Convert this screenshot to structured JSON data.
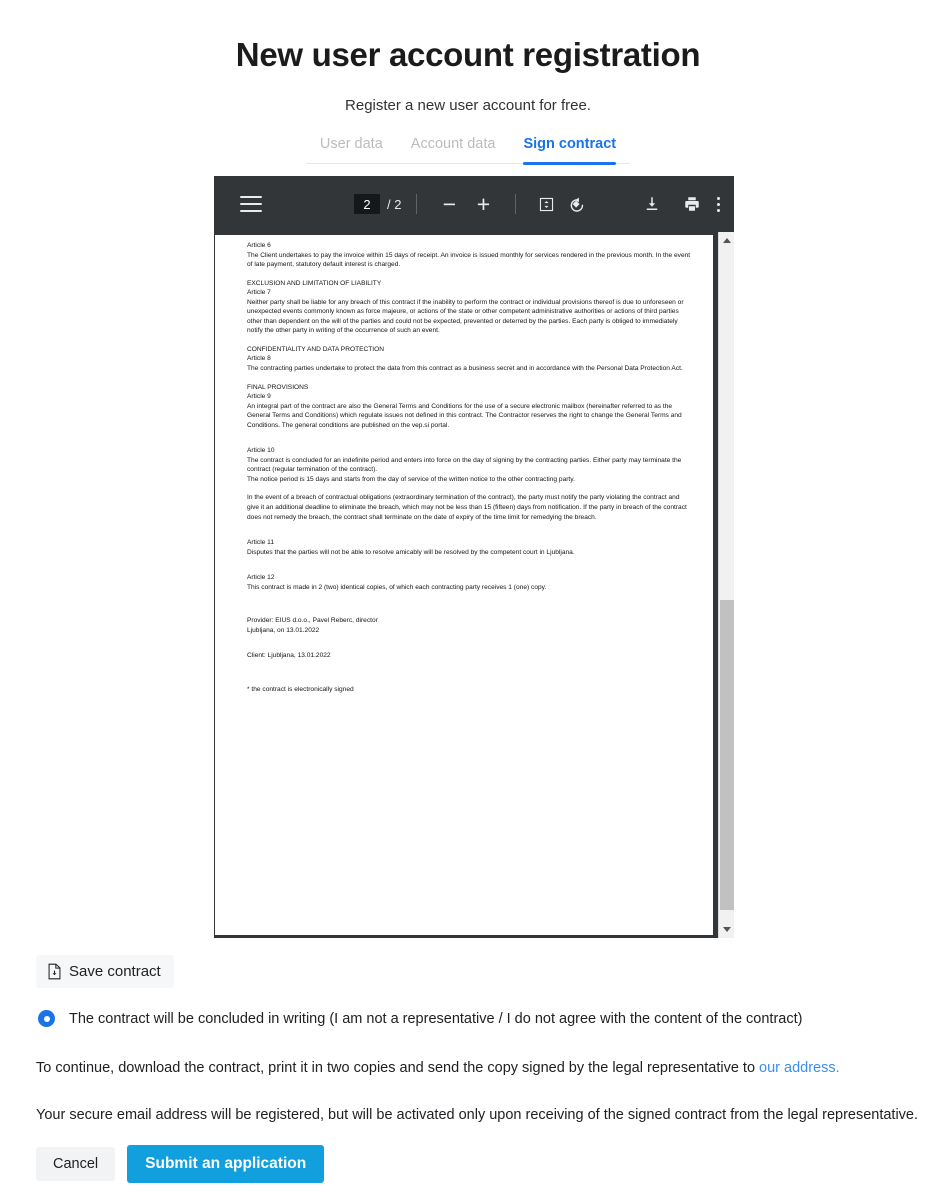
{
  "header": {
    "title": "New user account registration",
    "subtitle": "Register a new user account for free."
  },
  "tabs": [
    {
      "label": "User data",
      "active": false
    },
    {
      "label": "Account data",
      "active": false
    },
    {
      "label": "Sign contract",
      "active": true
    }
  ],
  "pdf_viewer": {
    "menu_icon": "hamburger-menu-icon",
    "current_page": "2",
    "page_separator": "/",
    "total_pages": "2",
    "zoom_out_label": "−",
    "zoom_in_label": "+",
    "fit_icon": "fit-to-page-icon",
    "rotate_icon": "rotate-counterclockwise-icon",
    "download_icon": "download-icon",
    "print_icon": "print-icon",
    "more_icon": "more-options-icon"
  },
  "document": {
    "blocks": [
      {
        "type": "heading",
        "text": "Article 6"
      },
      {
        "type": "body",
        "text": "The Client undertakes to pay the invoice within 15 days of receipt. An invoice is issued monthly for services rendered in the previous month. In the event of late payment, statutory default interest is charged."
      },
      {
        "type": "section",
        "text": "EXCLUSION AND LIMITATION OF LIABILITY"
      },
      {
        "type": "heading",
        "text": "Article 7"
      },
      {
        "type": "body",
        "text": "Neither party shall be liable for any breach of this contract if the inability to perform the contract or individual provisions thereof is due to unforeseen or unexpected events commonly known as force majeure, or actions of the state or other competent administrative authorities or actions of third parties other than dependent on the will of the parties and could not be expected, prevented or deterred by the parties. Each party is obliged to immediately notify the other party in writing of the occurrence of such an event."
      },
      {
        "type": "section",
        "text": "CONFIDENTIALITY AND DATA PROTECTION"
      },
      {
        "type": "heading",
        "text": "Article 8"
      },
      {
        "type": "body",
        "text": "The contracting parties undertake to protect the data from this contract as a business secret and in accordance with the Personal Data Protection Act."
      },
      {
        "type": "section",
        "text": "FINAL PROVISIONS"
      },
      {
        "type": "heading",
        "text": "Article 9"
      },
      {
        "type": "body",
        "text": "An integral part of the contract are also the General Terms and Conditions for the use of a secure electronic mailbox (hereinafter referred to as the General Terms and Conditions) which regulate issues not defined in this contract. The Contractor reserves the right to change the General Terms and Conditions. The general conditions are published on the vep.si portal."
      },
      {
        "type": "heading",
        "text": "Article 10"
      },
      {
        "type": "body",
        "text": "The contract is concluded for an indefinite period and enters into force on the day of signing by the contracting parties. Either party may terminate the contract (regular termination of the contract)."
      },
      {
        "type": "body",
        "text": "The notice period is 15 days and starts from the day of service of the written notice to the other contracting party."
      },
      {
        "type": "body",
        "text": "In the event of a breach of contractual obligations (extraordinary termination of the contract), the party must notify the party violating the contract and give it an additional deadline to eliminate the breach, which may not be less than 15 (fifteen) days from notification. If the party in breach of the contract does not remedy the breach, the contract shall terminate on the date of expiry of the time limit for remedying the breach."
      },
      {
        "type": "heading",
        "text": "Article 11"
      },
      {
        "type": "body",
        "text": "Disputes that the parties will not be able to resolve amicably will be resolved by the competent court in Ljubljana."
      },
      {
        "type": "heading",
        "text": "Article 12"
      },
      {
        "type": "body",
        "text": "This contract is made in 2 (two) identical copies, of which each contracting party receives 1 (one) copy."
      },
      {
        "type": "signature",
        "text": "Provider: EIUS d.o.o., Pavel Reberc, director"
      },
      {
        "type": "signature",
        "text": "Ljubljana, on 13.01.2022"
      },
      {
        "type": "signature",
        "text": "Client: Ljubljana, 13.01.2022"
      },
      {
        "type": "footnote",
        "text": "* the contract is electronically signed"
      }
    ]
  },
  "actions": {
    "save_contract_label": "Save contract",
    "save_contract_icon": "document-download-icon",
    "radio_label": "The contract will be concluded in writing (I am not a representative / I do not agree with the content of the contract)",
    "radio_selected": true,
    "note_1_before": "To continue, download the contract, print it in two copies and send the copy signed by the legal representative to ",
    "note_1_link": "our address.",
    "note_2": "Your secure email address will be registered, but will be activated only upon receiving of the signed contract from the legal representative.",
    "cancel_label": "Cancel",
    "submit_label": "Submit an application"
  },
  "colors": {
    "accent_blue": "#1a73e8",
    "submit_blue": "#11a0dd",
    "link_blue": "#3b8df0",
    "toolbar_dark": "#323639"
  }
}
